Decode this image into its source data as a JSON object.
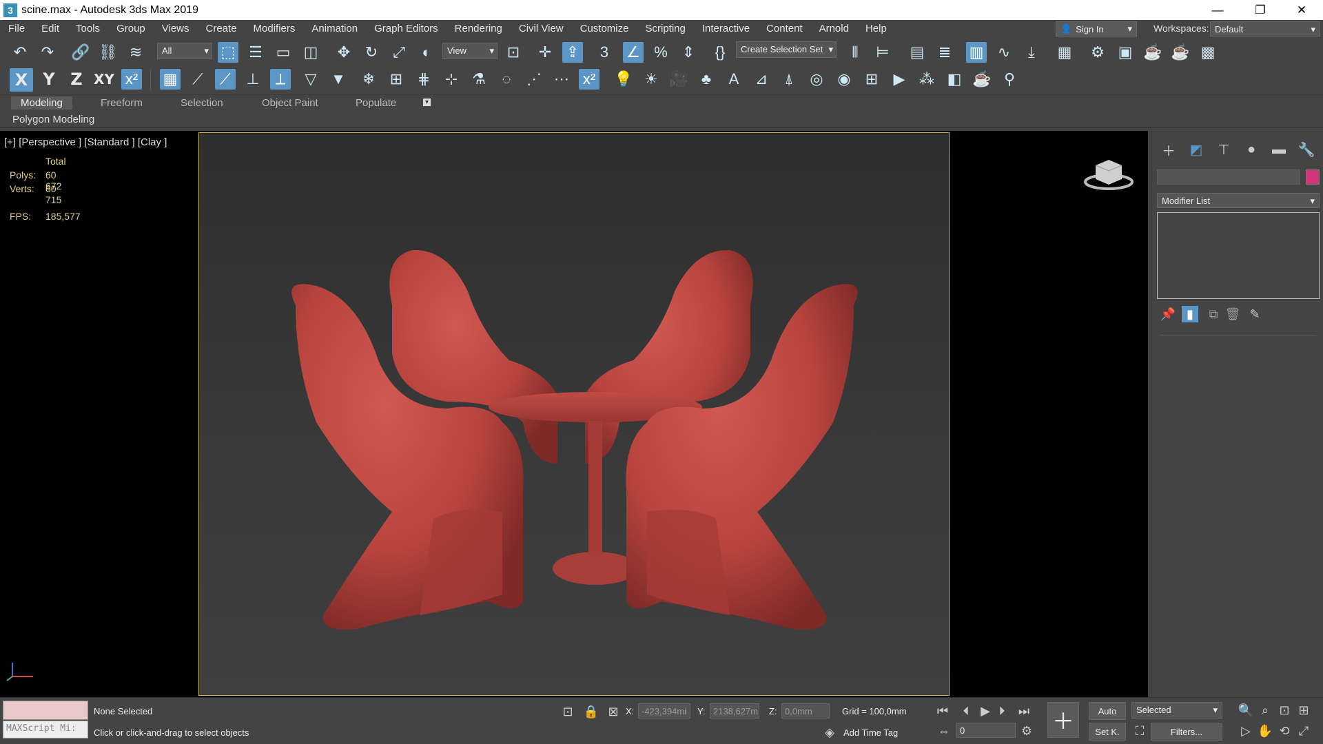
{
  "window": {
    "title": "scine.max - Autodesk 3ds Max 2019",
    "app_icon": "3"
  },
  "menu": [
    "File",
    "Edit",
    "Tools",
    "Group",
    "Views",
    "Create",
    "Modifiers",
    "Animation",
    "Graph Editors",
    "Rendering",
    "Civil View",
    "Customize",
    "Scripting",
    "Interactive",
    "Content",
    "Arnold",
    "Help"
  ],
  "account": {
    "signin": "Sign In",
    "workspaces_label": "Workspaces:",
    "workspace": "Default"
  },
  "toolbar": {
    "selection_filter": "All",
    "ref_coord": "View",
    "selection_set": "Create Selection Set",
    "axes": [
      "X",
      "Y",
      "Z",
      "XY"
    ]
  },
  "ribbon": {
    "tabs": [
      "Modeling",
      "Freeform",
      "Selection",
      "Object Paint",
      "Populate"
    ],
    "active": "Modeling",
    "panel": "Polygon Modeling"
  },
  "viewport": {
    "label": "[+] [Perspective ] [Standard ] [Clay ]",
    "stats": {
      "header": "Total",
      "polys_label": "Polys:",
      "polys": "60 672",
      "verts_label": "Verts:",
      "verts": "60 715",
      "fps_label": "FPS:",
      "fps": "185,577"
    }
  },
  "command_panel": {
    "modifier_list": "Modifier List",
    "object_color": "#d1357a"
  },
  "status": {
    "selection": "None Selected",
    "prompt": "Click or click-and-drag to select objects",
    "maxscript_placeholder": "MAXScript Mi:",
    "x_label": "X:",
    "x": "-423,394mi",
    "y_label": "Y:",
    "y": "2138,627m",
    "z_label": "Z:",
    "z": "0,0mm",
    "grid": "Grid = 100,0mm",
    "add_time_tag": "Add Time Tag",
    "auto": "Auto",
    "selected": "Selected",
    "frame": "0",
    "set_key": "Set K.",
    "filters": "Filters..."
  },
  "colors": {
    "chairs": "#b9443e",
    "viewport_border": "#c9b35a",
    "active_button": "#5b96c6"
  }
}
